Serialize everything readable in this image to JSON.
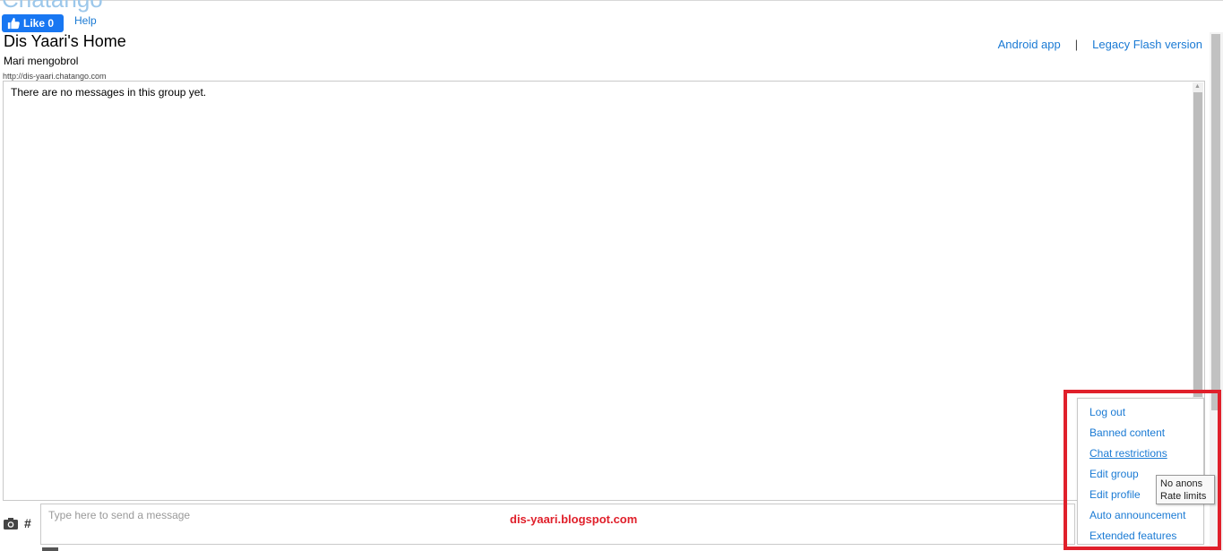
{
  "brand": "Chatango",
  "header": {
    "like_label": "Like 0",
    "help_label": "Help",
    "group_title": "Dis Yaari's Home",
    "group_subtitle": "Mari mengobrol",
    "group_url": "http://dis-yaari.chatango.com",
    "android_link": "Android app",
    "separator": "|",
    "legacy_link": "Legacy Flash version"
  },
  "chat": {
    "empty_message": "There are no messages in this group yet."
  },
  "composer": {
    "placeholder": "Type here to send a message",
    "hash_label": "#"
  },
  "watermark": "dis-yaari.blogspot.com",
  "menu": {
    "items": [
      {
        "label": "Log out"
      },
      {
        "label": "Banned content"
      },
      {
        "label": "Chat restrictions"
      },
      {
        "label": "Edit group"
      },
      {
        "label": "Edit profile"
      },
      {
        "label": "Auto announcement"
      },
      {
        "label": "Extended features"
      }
    ]
  },
  "tooltip": {
    "line1": "No anons",
    "line2": "Rate limits"
  },
  "colors": {
    "link": "#1a7ad4",
    "like_button": "#1877f2",
    "highlight_box": "#e0202b",
    "watermark": "#e0202b"
  },
  "icons": [
    "thumbs-up-icon",
    "camera-icon",
    "hash-icon"
  ]
}
